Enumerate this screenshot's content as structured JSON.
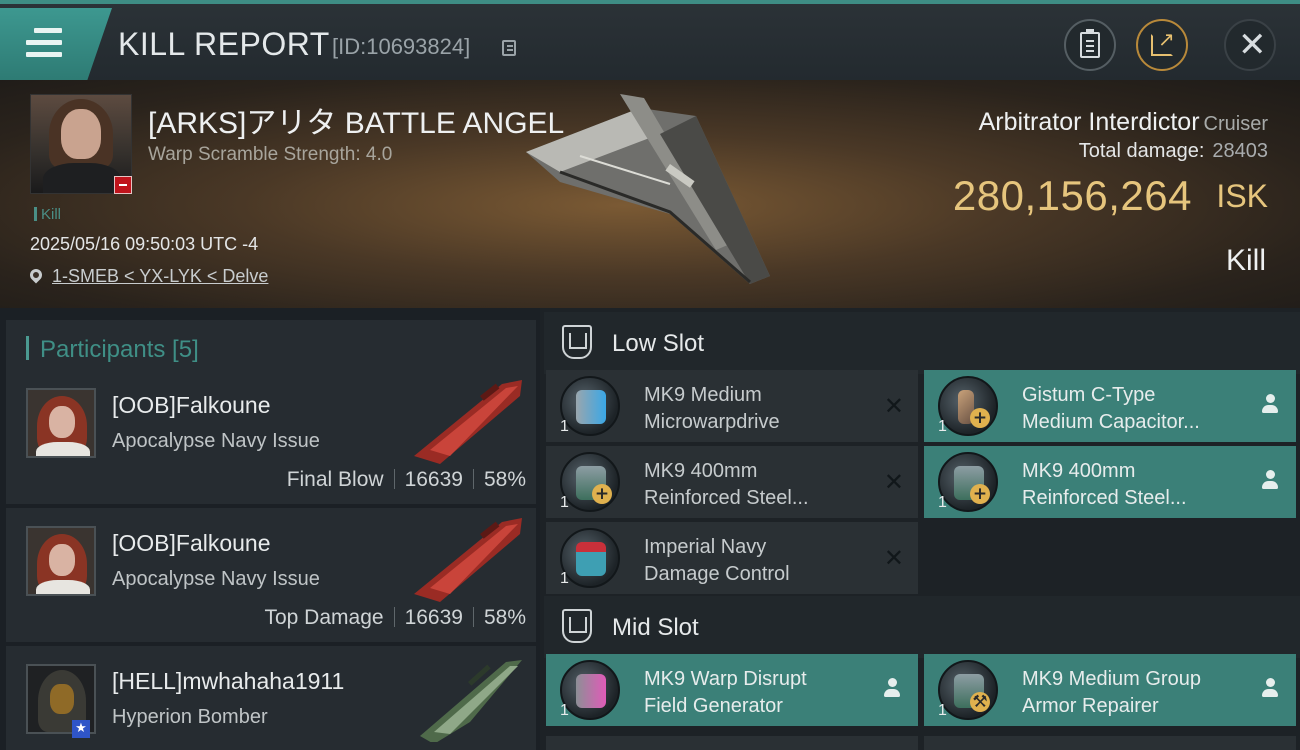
{
  "header": {
    "title": "KILL REPORT",
    "report_id": "[ID:10693824]"
  },
  "victim": {
    "name": "[ARKS]アリタ BATTLE ANGEL",
    "warp_scramble": "Warp Scramble Strength: 4.0",
    "kill_tag": "Kill",
    "datetime": "2025/05/16 09:50:03 UTC -4",
    "location": "1-SMEB < YX-LYK < Delve",
    "ship_name": "Arbitrator Interdictor",
    "ship_class": "Cruiser",
    "total_damage_label": "Total damage:",
    "total_damage": "28403",
    "isk_value": "280,156,264",
    "isk_label": "ISK",
    "result": "Kill"
  },
  "participants": {
    "title": "Participants [5]",
    "rows": [
      {
        "name": "[OOB]Falkoune",
        "ship": "Apocalypse Navy Issue",
        "role": "Final Blow",
        "damage": "16639",
        "percent": "58%"
      },
      {
        "name": "[OOB]Falkoune",
        "ship": "Apocalypse Navy Issue",
        "role": "Top Damage",
        "damage": "16639",
        "percent": "58%"
      },
      {
        "name": "[HELL]mwhahaha1911",
        "ship": "Hyperion Bomber"
      }
    ]
  },
  "fitting": {
    "low_slot_title": "Low Slot",
    "mid_slot_title": "Mid Slot",
    "low": [
      {
        "qty": "1",
        "line1": "MK9 Medium",
        "line2": "Microwarpdrive",
        "status": "destroyed"
      },
      {
        "qty": "1",
        "line1": "Gistum C-Type",
        "line2": "Medium Capacitor...",
        "status": "dropped"
      },
      {
        "qty": "1",
        "line1": "MK9 400mm",
        "line2": "Reinforced Steel...",
        "status": "destroyed"
      },
      {
        "qty": "1",
        "line1": "MK9 400mm",
        "line2": "Reinforced Steel...",
        "status": "dropped"
      },
      {
        "qty": "1",
        "line1": "Imperial Navy",
        "line2": "Damage Control",
        "status": "destroyed"
      }
    ],
    "mid": [
      {
        "qty": "1",
        "line1": "MK9 Warp Disrupt",
        "line2": "Field Generator",
        "status": "dropped"
      },
      {
        "qty": "1",
        "line1": "MK9 Medium Group",
        "line2": "Armor Repairer",
        "status": "dropped"
      }
    ],
    "status_symbol": "✕"
  },
  "colors": {
    "accent": "#3e8d84",
    "fitted_bg": "#3b8078",
    "isk_gold": "#e6c57d"
  }
}
